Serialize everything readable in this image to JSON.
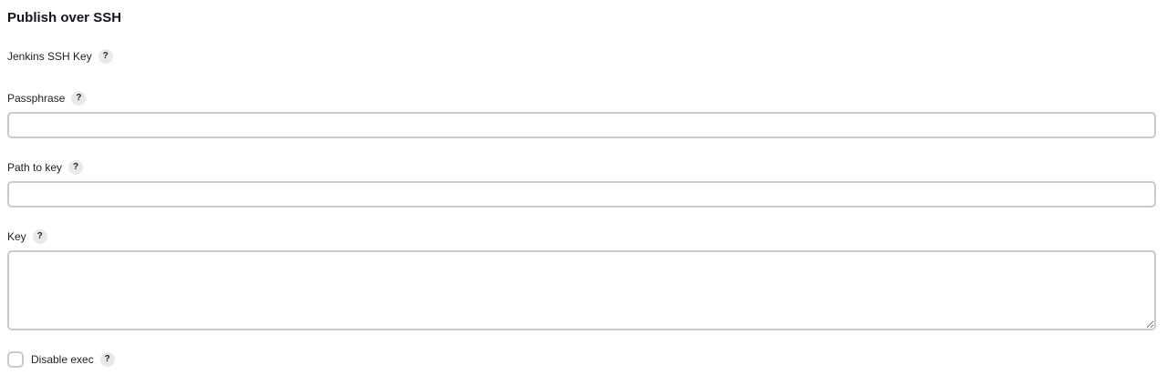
{
  "section": {
    "title": "Publish over SSH"
  },
  "fields": {
    "jenkins_ssh_key": {
      "label": "Jenkins SSH Key",
      "help": "?"
    },
    "passphrase": {
      "label": "Passphrase",
      "help": "?",
      "value": ""
    },
    "path_to_key": {
      "label": "Path to key",
      "help": "?",
      "value": ""
    },
    "key": {
      "label": "Key",
      "help": "?",
      "value": ""
    },
    "disable_exec": {
      "label": "Disable exec",
      "help": "?",
      "checked": false
    }
  }
}
